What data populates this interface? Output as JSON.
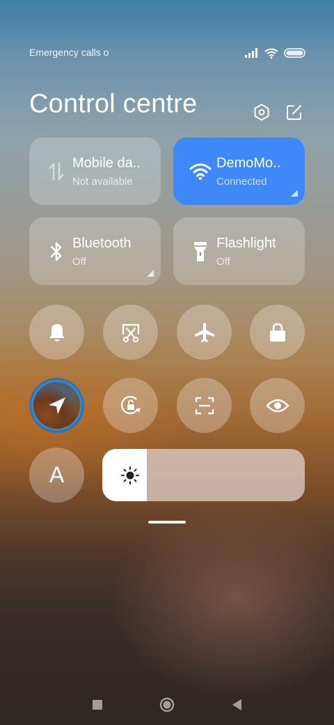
{
  "status_bar": {
    "carrier_text": "Emergency calls o",
    "icons": [
      "signal-icon",
      "wifi-icon",
      "battery-icon"
    ]
  },
  "header": {
    "title": "Control centre",
    "icons": [
      "settings-icon",
      "edit-icon"
    ]
  },
  "tiles": [
    {
      "id": "mobile-data",
      "name": "Mobile da..",
      "status": "Not available",
      "icon": "mobile-data-icon",
      "active": false
    },
    {
      "id": "wifi",
      "name": "DemoMo..",
      "status": "Connected",
      "icon": "wifi-icon",
      "active": true
    },
    {
      "id": "bluetooth",
      "name": "Bluetooth",
      "status": "Off",
      "icon": "bluetooth-icon",
      "active": false
    },
    {
      "id": "flashlight",
      "name": "Flashlight",
      "status": "Off",
      "icon": "flashlight-icon",
      "active": false
    }
  ],
  "round_buttons": {
    "row1": [
      "bell-icon",
      "screenshot-icon",
      "airplane-icon",
      "lock-icon"
    ],
    "row2": [
      "location-icon",
      "rotation-lock-icon",
      "scan-icon",
      "eye-icon"
    ],
    "font_button_label": "A"
  },
  "brightness": {
    "level": 0.22,
    "icon": "sun-icon"
  },
  "nav_bar": {
    "icons": [
      "recents-icon",
      "home-icon",
      "back-icon"
    ]
  },
  "colors": {
    "active_tile": "#3f88fa",
    "tile_bg": "rgba(255,255,255,0.22)"
  }
}
